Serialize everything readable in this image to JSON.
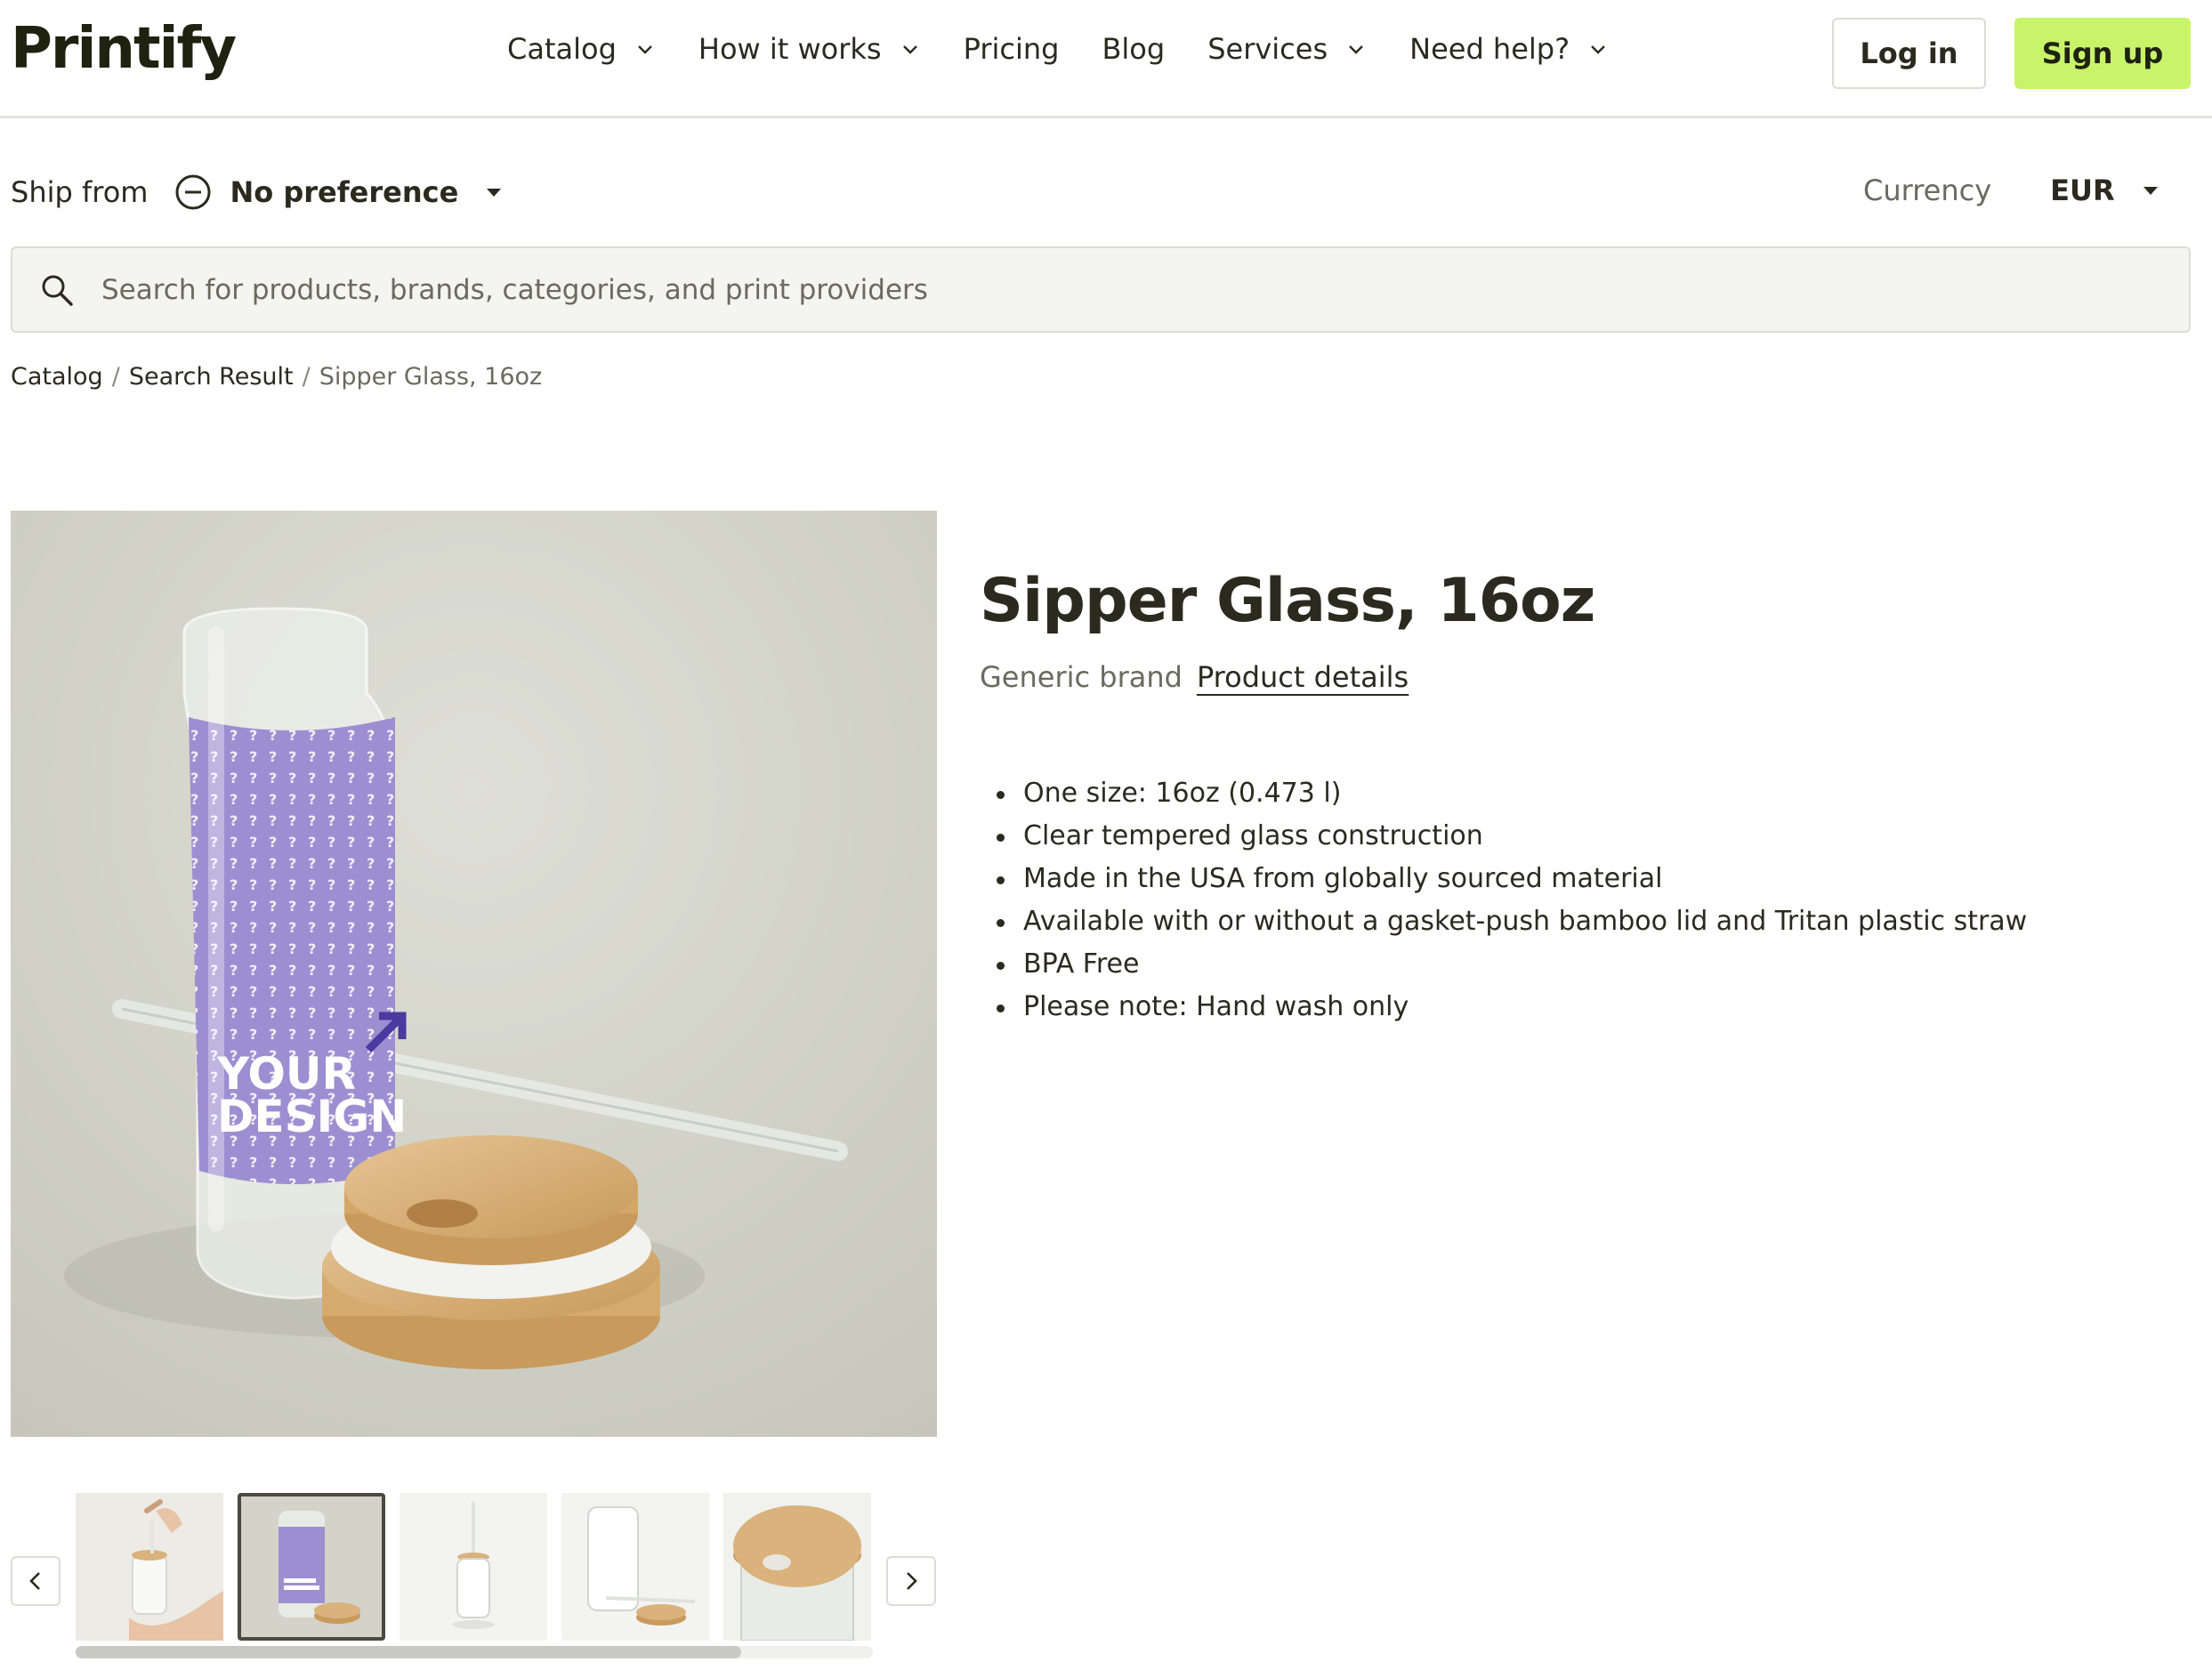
{
  "brand": {
    "logo_text": "Printify"
  },
  "nav": {
    "items": [
      {
        "label": "Catalog",
        "dropdown": true
      },
      {
        "label": "How it works",
        "dropdown": true
      },
      {
        "label": "Pricing",
        "dropdown": false
      },
      {
        "label": "Blog",
        "dropdown": false
      },
      {
        "label": "Services",
        "dropdown": true
      },
      {
        "label": "Need help?",
        "dropdown": true
      }
    ],
    "login_label": "Log in",
    "signup_label": "Sign up"
  },
  "filters": {
    "ship_from_label": "Ship from",
    "ship_from_value": "No preference",
    "currency_label": "Currency",
    "currency_value": "EUR"
  },
  "search": {
    "placeholder": "Search for products, brands, categories, and print providers",
    "value": ""
  },
  "breadcrumb": {
    "items": [
      "Catalog",
      "Search Result"
    ],
    "current": "Sipper Glass, 16oz",
    "separator": "/"
  },
  "product": {
    "title": "Sipper Glass, 16oz",
    "brand": "Generic brand",
    "details_link": "Product details",
    "features": [
      "One size: 16oz (0.473 l)",
      "Clear tempered glass construction",
      "Made in the USA from globally sourced material",
      "Available with or without a gasket-push bamboo lid and Tritan plastic straw",
      "BPA Free",
      "Please note: Hand wash only"
    ],
    "mockup_text_line1": "YOUR",
    "mockup_text_line2": "DESIGN"
  },
  "gallery": {
    "thumbnails": [
      {
        "name": "hand-holding-glass",
        "active": false
      },
      {
        "name": "purple-design-glass",
        "active": true
      },
      {
        "name": "glass-with-straw",
        "active": false
      },
      {
        "name": "clear-glass-with-lid",
        "active": false
      },
      {
        "name": "bamboo-lid-closeup",
        "active": false
      }
    ],
    "scroll_fraction": 0.835
  },
  "colors": {
    "accent_green": "#c8f46a",
    "text_dark": "#2b2a1f",
    "text_muted": "#6b6a5e",
    "design_purple": "#9c8fd1",
    "bamboo": "#d9b27c"
  }
}
